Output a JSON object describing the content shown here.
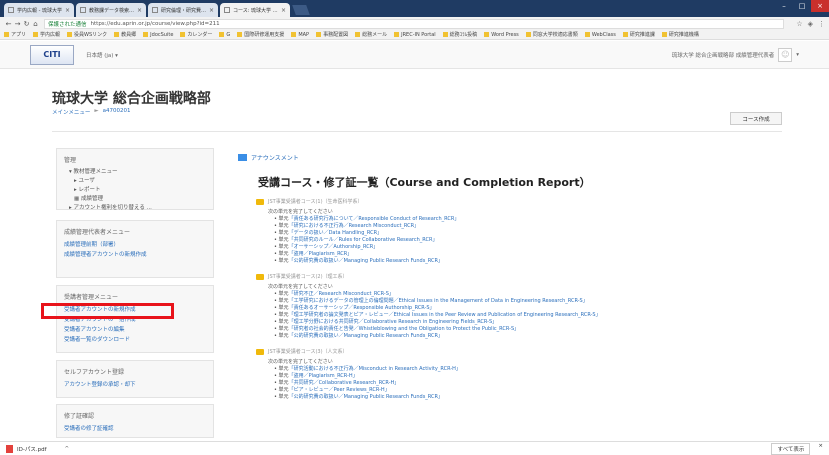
{
  "browser": {
    "tabs": [
      {
        "label": "学内広報 - 琉球大学",
        "active": false
      },
      {
        "label": "教務課データ検索結果",
        "active": false
      },
      {
        "label": "研究倫理・研究費出口",
        "active": false
      },
      {
        "label": "コース: 琉球大学 総合企",
        "active": true
      }
    ],
    "secure_label": "保護された通信",
    "url": "https://edu.aprin.or.jp/course/view.php?id=211",
    "bookmarks": [
      "アプリ",
      "学内広報",
      "役員WSリンク",
      "教員郷",
      "JdocSuite",
      "カレンダー",
      "G",
      "国際研修運用支援",
      "MAP",
      "事務配置図",
      "総務メール",
      "JREC-IN Portal",
      "総務ｺﾗﾑ投稿",
      "Word Press",
      "同窓大学校適応書類",
      "WebClass",
      "研究推進課",
      "研究推進機構"
    ]
  },
  "header": {
    "logo": "CITI",
    "language": "日本語 (ja) ▾",
    "user": "琉球大学 総合企画戦略部 成績管理代表者"
  },
  "page": {
    "title": "琉球大学 総合企画戦略部",
    "breadcrumb": [
      "メインメニュー",
      "a4700201"
    ],
    "course_edit_button": "コース作成"
  },
  "sidebar": {
    "admin": {
      "title": "管理",
      "items": [
        "教材管理メニュー",
        "ユーザ",
        "レポート",
        "成績管理",
        "アカウント権利を切り替える ..."
      ]
    },
    "grade_manager": {
      "title": "成績管理代表者メニュー",
      "links": [
        "成績管理前期（部署）",
        "成績管理者アカウントの新規作成"
      ]
    },
    "learner_manager": {
      "title": "受講者管理メニュー",
      "links": [
        "受講者アカウントの新規作成",
        "受講者アカウントの一括作成",
        "受講者アカウントの編集",
        "受講者一覧のダウンロード"
      ]
    },
    "self_account": {
      "title": "セルフアカウント登録",
      "links": [
        "アカウント登録の承認・却下"
      ]
    },
    "completion": {
      "title": "修了証確認",
      "links": [
        "受講者の修了証確認"
      ]
    }
  },
  "main": {
    "announcement": "アナウンスメント",
    "report_title": "受講コース・修了証一覧（Course and Completion Report）",
    "sections": [
      {
        "heading": "JST事業受講者コース(1)（生命医科学系）",
        "sub": "次の単元を完了してください",
        "units": [
          "「責任ある研究行為について／Responsible Conduct of Research_RCR」",
          "「研究における不正行為／Research Misconduct_RCR」",
          "「データの扱い／Data Handling_RCR」",
          "「共同研究のルール／Rules for Collaborative Research_RCR」",
          "「オーサーシップ／Authorship_RCR」",
          "「盗用／Plagiarism_RCR」",
          "「公的研究費の取扱い／Managing Public Research Funds_RCR」"
        ]
      },
      {
        "heading": "JST事業受講者コース(2)（理工系）",
        "sub": "次の単元を完了してください",
        "units": [
          "「研究不正／Research Misconduct_RCR-S」",
          "「工学研究におけるデータの管理上の倫理問題／Ethical Issues in the Management of Data in Engineering Research_RCR-S」",
          "「責任あるオーサーシップ／Responsible Authorship_RCR-S」",
          "「理工学研究者の論文発表とピア・レビュー／Ethical Issues in the Peer Review and Publication of Engineering Research_RCR-S」",
          "「理工学分野における共同研究／Collaborative Research in Engineering Fields_RCR-S」",
          "「研究者の社会的責任と告発／Whistleblowing and the Obligation to Protect the Public_RCR-S」",
          "「公的研究費の取扱い／Managing Public Research Funds_RCR」"
        ]
      },
      {
        "heading": "JST事業受講者コース(3)（人文系）",
        "sub": "次の単元を完了してください",
        "units": [
          "「研究活動における不正行為／Misconduct in Research Activity_RCR-H」",
          "「盗用／Plagiarism_RCR-H」",
          "「共同研究／Collaborative Research_RCR-H」",
          "「ピア・レビュー／Peer Reviews_RCR-H」",
          "「公的研究費の取扱い／Managing Public Research Funds_RCR」"
        ]
      }
    ],
    "unit_prefix": "単元"
  },
  "downloads": {
    "file": "ID-パス.pdf",
    "show_all": "すべて表示",
    "close": "×"
  },
  "colors": {
    "link": "#2a6ebb",
    "highlight": "#e8131a",
    "tabstrip": "#1f3b63"
  }
}
